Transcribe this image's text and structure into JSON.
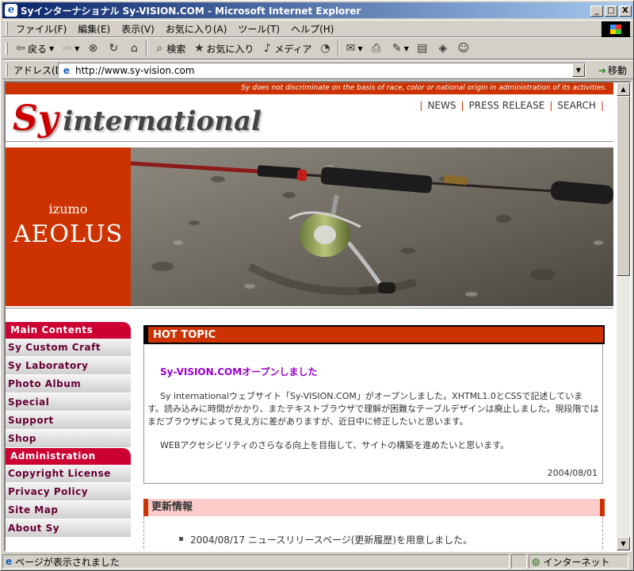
{
  "window": {
    "title": "Syインターナショナル Sy-VISION.COM - Microsoft Internet Explorer",
    "controls": [
      "_",
      "□",
      "X"
    ]
  },
  "menu": [
    "ファイル(F)",
    "編集(E)",
    "表示(V)",
    "お気に入り(A)",
    "ツール(T)",
    "ヘルプ(H)"
  ],
  "toolbar": {
    "back": "戻る",
    "search": "検索",
    "favorites": "お気に入り",
    "media": "メディア"
  },
  "address": {
    "label": "アドレス(D)",
    "url": "http://www.sy-vision.com",
    "go": "移動"
  },
  "site": {
    "notice": "Sy does not discriminate on the basis of race, color or national origin in administration of its activities.",
    "logo_s": "Sy",
    "logo_rest": "international",
    "topnav": [
      "NEWS",
      "PRESS RELEASE",
      "SEARCH"
    ],
    "hero_sub": "izumo",
    "hero_main": "AEOLUS",
    "sidebar": {
      "main_title": "Main Contents",
      "main_items": [
        "Sy Custom Craft",
        "Sy Laboratory",
        "Photo Album",
        "Special",
        "Support",
        "Shop"
      ],
      "admin_title": "Administration",
      "admin_items": [
        "Copyright License",
        "Privacy Policy",
        "Site Map",
        "About Sy"
      ]
    },
    "hot_topic": {
      "header": "HOT TOPIC",
      "title": "Sy-VISION.COMオープンしました",
      "para1": "Sy internationalウェブサイト「Sy-VISION.COM」がオープンしました。XHTML1.0とCSSで記述しています。読み込みに時間がかかり、またテキストブラウザで理解が困難なテーブルデザインは廃止しました。現段階ではまだブラウザによって見え方に差がありますが、近日中に修正したいと思います。",
      "para2": "WEBアクセシビリティのさらなる向上を目指して、サイトの構築を進めたいと思います。",
      "date": "2004/08/01"
    },
    "updates": {
      "header": "更新情報",
      "items": [
        "2004/08/17 ニュースリリースページ(更新履歴)を用意しました。"
      ]
    }
  },
  "status": {
    "text": "ページが表示されました",
    "zone": "インターネット"
  }
}
